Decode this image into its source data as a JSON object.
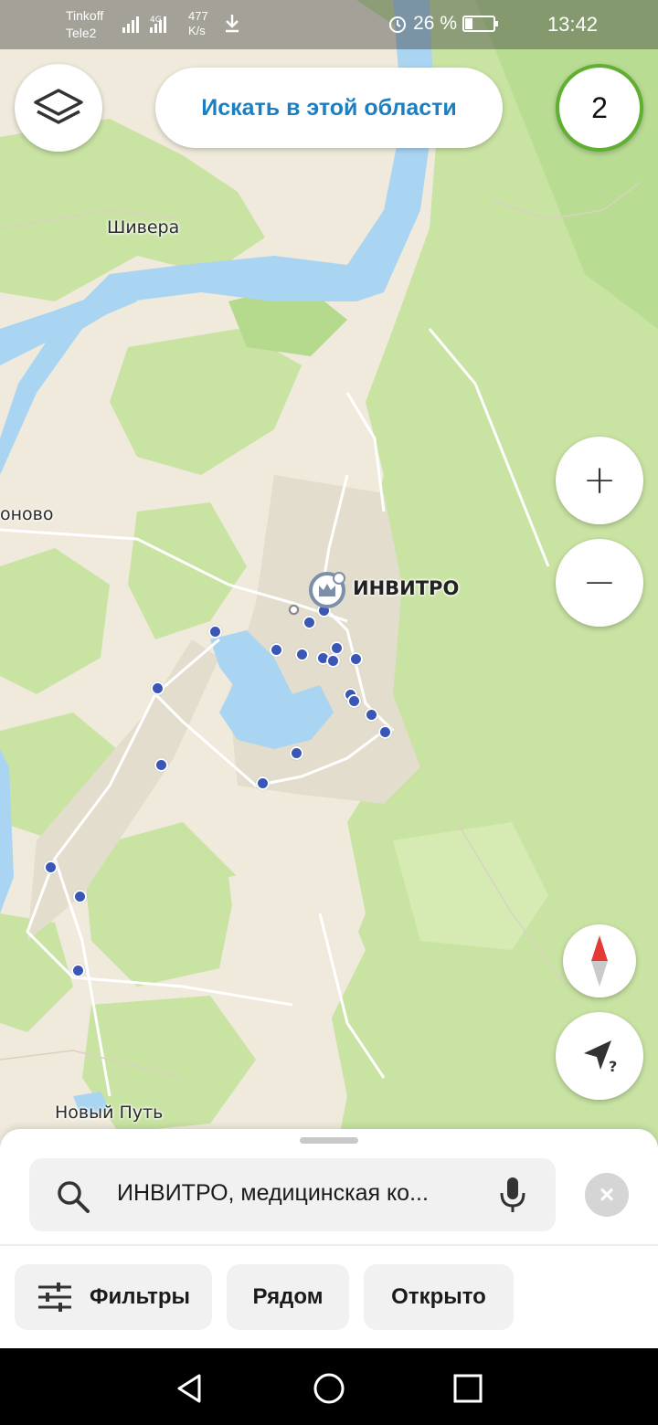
{
  "status_bar": {
    "carrier_1": "Tinkoff",
    "carrier_2": "Tele2",
    "net_speed_value": "477",
    "net_speed_unit": "K/s",
    "net_type": "4G",
    "battery_percent": "26 %",
    "battery_level": 0.26,
    "time": "13:42",
    "icons": [
      "signal-icon",
      "download-icon",
      "alarm-icon",
      "battery-icon"
    ]
  },
  "map": {
    "labels": {
      "shivera": "Шивера",
      "onovo": "оново",
      "noviy_put": "Новый Путь"
    },
    "main_pin_label": "ИНВИТРО",
    "colors": {
      "forest": "#c9e3a3",
      "forest_dark": "#b5d98d",
      "land": "#efeadb",
      "water": "#a9d4f2",
      "poi": "#3a57b6"
    }
  },
  "controls": {
    "search_area_label": "Искать в этой области",
    "result_count": "2",
    "zoom_in_label": "+",
    "zoom_out_label": "−",
    "locate_hint": "?"
  },
  "search": {
    "query": "ИНВИТРО, медицинская ко...",
    "clear_label": "×"
  },
  "chips": {
    "filters": "Фильтры",
    "nearby": "Рядом",
    "open": "Открыто"
  }
}
